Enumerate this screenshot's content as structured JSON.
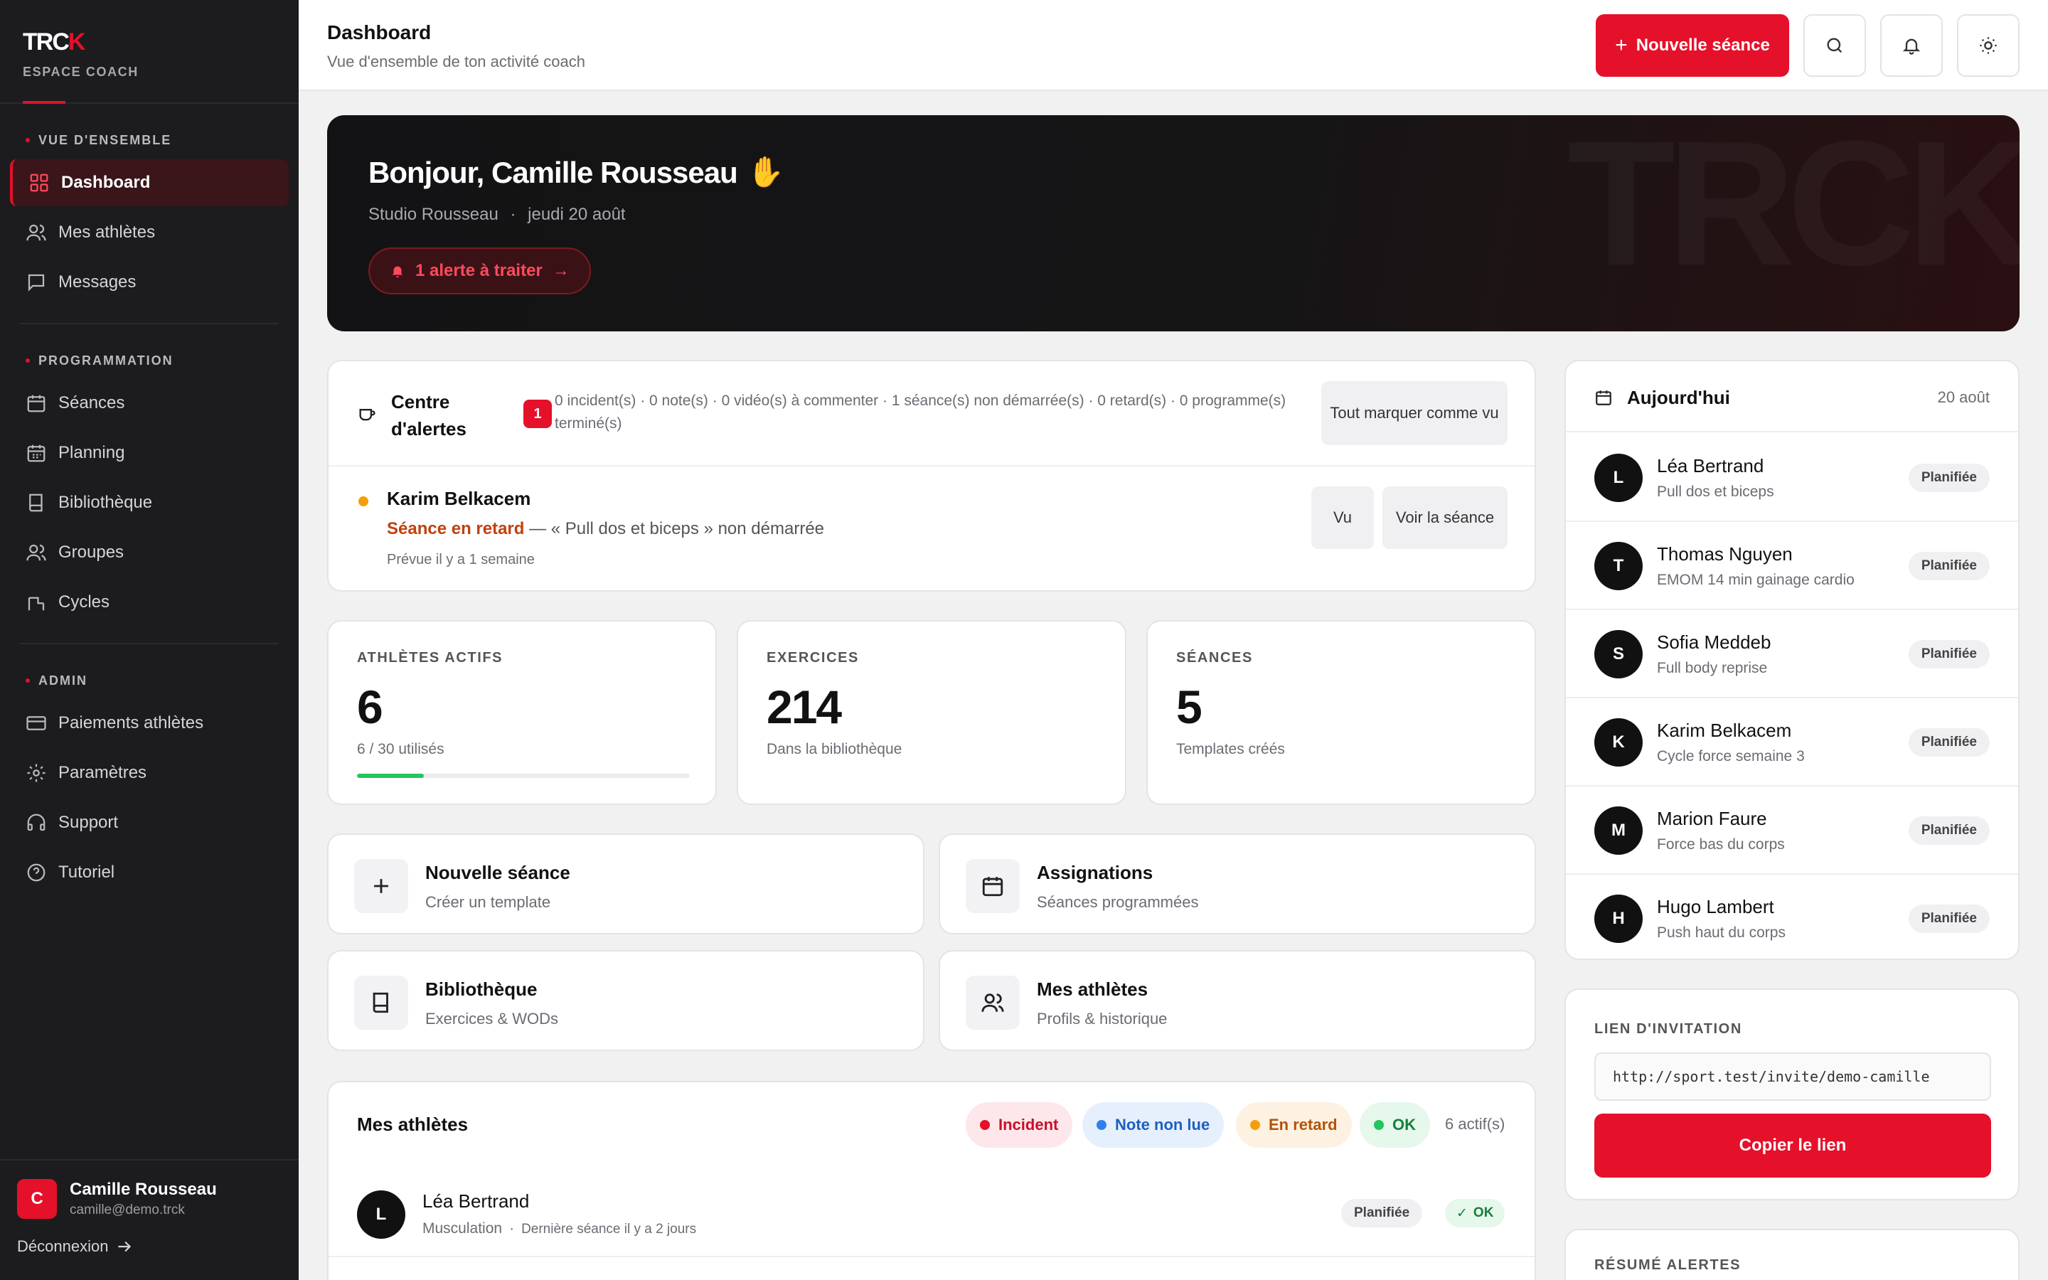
{
  "brand": {
    "logo_main": "TRC",
    "logo_accent": "K",
    "subtitle": "ESPACE COACH"
  },
  "sidebar": {
    "sections": [
      {
        "heading": "VUE D'ENSEMBLE",
        "items": [
          {
            "label": "Dashboard",
            "icon": "grid-icon",
            "active": true
          },
          {
            "label": "Mes athlètes",
            "icon": "users-icon"
          },
          {
            "label": "Messages",
            "icon": "message-icon"
          }
        ]
      },
      {
        "heading": "PROGRAMMATION",
        "items": [
          {
            "label": "Séances",
            "icon": "calendar-icon"
          },
          {
            "label": "Planning",
            "icon": "calendar-grid-icon"
          },
          {
            "label": "Bibliothèque",
            "icon": "book-icon"
          },
          {
            "label": "Groupes",
            "icon": "group-icon"
          },
          {
            "label": "Cycles",
            "icon": "cycle-icon"
          }
        ]
      },
      {
        "heading": "ADMIN",
        "items": [
          {
            "label": "Paiements athlètes",
            "icon": "card-icon"
          },
          {
            "label": "Paramètres",
            "icon": "gear-icon"
          },
          {
            "label": "Support",
            "icon": "headset-icon"
          },
          {
            "label": "Tutoriel",
            "icon": "help-icon"
          }
        ]
      }
    ],
    "user": {
      "initial": "C",
      "name": "Camille Rousseau",
      "email": "camille@demo.trck"
    },
    "logout_label": "Déconnexion"
  },
  "header": {
    "title": "Dashboard",
    "subtitle": "Vue d'ensemble de ton activité coach",
    "new_session_label": "Nouvelle séance"
  },
  "hero": {
    "greeting": "Bonjour, Camille Rousseau",
    "emoji": "✋",
    "studio": "Studio Rousseau",
    "separator": "·",
    "date": "jeudi 20 août",
    "alert_label": "1 alerte à traiter",
    "watermark": "TRCK"
  },
  "alerts": {
    "title": "Centre d'alertes",
    "badge": "1",
    "summary": "0 incident(s) · 0 note(s) · 0 vidéo(s) à commenter · 1 séance(s) non démarrée(s) · 0 retard(s) · 0 programme(s) terminé(s)",
    "mark_all_label": "Tout marquer comme vu",
    "item": {
      "name": "Karim Belkacem",
      "status": "Séance en retard",
      "detail": " — « Pull dos et biceps » non démarrée",
      "when": "Prévue il y a 1 semaine",
      "seen_label": "Vu",
      "view_label": "Voir la séance"
    }
  },
  "stats": [
    {
      "label": "ATHLÈTES ACTIFS",
      "value": "6",
      "note": "6 / 30 utilisés",
      "progress": 0.2
    },
    {
      "label": "EXERCICES",
      "value": "214",
      "note": "Dans la bibliothèque"
    },
    {
      "label": "SÉANCES",
      "value": "5",
      "note": "Templates créés"
    }
  ],
  "shortcuts": [
    {
      "title": "Nouvelle séance",
      "sub": "Créer un template",
      "icon": "plus-icon"
    },
    {
      "title": "Assignations",
      "sub": "Séances programmées",
      "icon": "calendar-icon"
    },
    {
      "title": "Bibliothèque",
      "sub": "Exercices & WODs",
      "icon": "book-icon"
    },
    {
      "title": "Mes athlètes",
      "sub": "Profils & historique",
      "icon": "users-icon"
    }
  ],
  "athletes": {
    "title": "Mes athlètes",
    "filters": [
      {
        "label": "Incident",
        "color": "#e5102a",
        "bg": "#fde7ea",
        "fg": "#c8102a"
      },
      {
        "label": "Note non lue",
        "color": "#2f80ed",
        "bg": "#e6f0fd",
        "fg": "#1d5fc1"
      },
      {
        "label": "En retard",
        "color": "#f59e0b",
        "bg": "#fdf1e1",
        "fg": "#b45309"
      },
      {
        "label": "OK",
        "color": "#22c55e",
        "bg": "#e6f7ec",
        "fg": "#15803d"
      }
    ],
    "count": "6 actif(s)",
    "rows": [
      {
        "initial": "L",
        "name": "Léa Bertrand",
        "discipline": "Musculation",
        "last": "Dernière séance il y a 2 jours",
        "status": "Planifiée",
        "ok": "OK"
      }
    ]
  },
  "today": {
    "title": "Aujourd'hui",
    "date": "20 août",
    "items": [
      {
        "initial": "L",
        "name": "Léa Bertrand",
        "session": "Pull dos et biceps",
        "status": "Planifiée"
      },
      {
        "initial": "T",
        "name": "Thomas Nguyen",
        "session": "EMOM 14 min gainage cardio",
        "status": "Planifiée"
      },
      {
        "initial": "S",
        "name": "Sofia Meddeb",
        "session": "Full body reprise",
        "status": "Planifiée"
      },
      {
        "initial": "K",
        "name": "Karim Belkacem",
        "session": "Cycle force semaine 3",
        "status": "Planifiée"
      },
      {
        "initial": "M",
        "name": "Marion Faure",
        "session": "Force bas du corps",
        "status": "Planifiée"
      },
      {
        "initial": "H",
        "name": "Hugo Lambert",
        "session": "Push haut du corps",
        "status": "Planifiée"
      }
    ]
  },
  "invite": {
    "label": "LIEN D'INVITATION",
    "url": "http://sport.test/invite/demo-camille",
    "copy_label": "Copier le lien"
  },
  "summary": {
    "label": "RÉSUMÉ ALERTES"
  },
  "colors": {
    "accent": "#e5102a",
    "sidebar": "#1c1c1f",
    "ok": "#22c55e",
    "warning": "#f59e0b"
  }
}
